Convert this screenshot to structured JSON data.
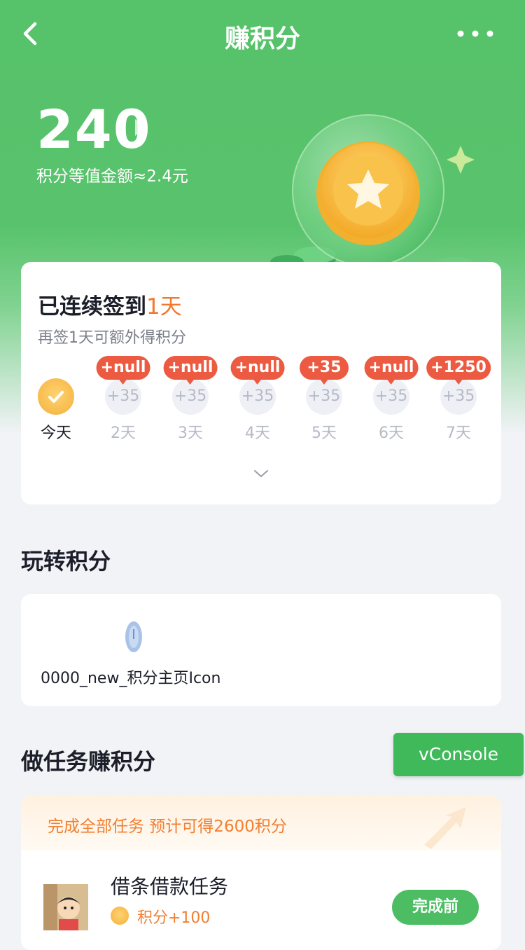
{
  "header": {
    "title": "赚积分",
    "back_icon": "chevron-left-icon",
    "more_icon": "more-dots-icon"
  },
  "points": {
    "value": "240",
    "equivalent": "积分等值金额≈2.4元"
  },
  "signin": {
    "title_prefix": "已连续签到",
    "title_days": "1天",
    "subtitle": "再签1天可额外得积分",
    "days": [
      {
        "label": "今天",
        "value": "",
        "badge": "",
        "checked": true
      },
      {
        "label": "2天",
        "value": "+35",
        "badge": "+null"
      },
      {
        "label": "3天",
        "value": "+35",
        "badge": "+null"
      },
      {
        "label": "4天",
        "value": "+35",
        "badge": "+null"
      },
      {
        "label": "5天",
        "value": "+35",
        "badge": "+35"
      },
      {
        "label": "6天",
        "value": "+35",
        "badge": "+null"
      },
      {
        "label": "7天",
        "value": "+35",
        "badge": "+1250"
      }
    ]
  },
  "play": {
    "section_title": "玩转积分",
    "items": [
      {
        "label": "0000_new_积分主页Icon"
      }
    ]
  },
  "vconsole": {
    "label": "vConsole"
  },
  "tasks": {
    "section_title": "做任务赚积分",
    "banner": "完成全部任务 预计可得2600积分",
    "items": [
      {
        "name": "借条借款任务",
        "reward": "积分+100",
        "button": "完成前"
      }
    ]
  },
  "colors": {
    "green": "#56c26a",
    "orange": "#f3772c",
    "red_badge": "#ec5a41"
  }
}
